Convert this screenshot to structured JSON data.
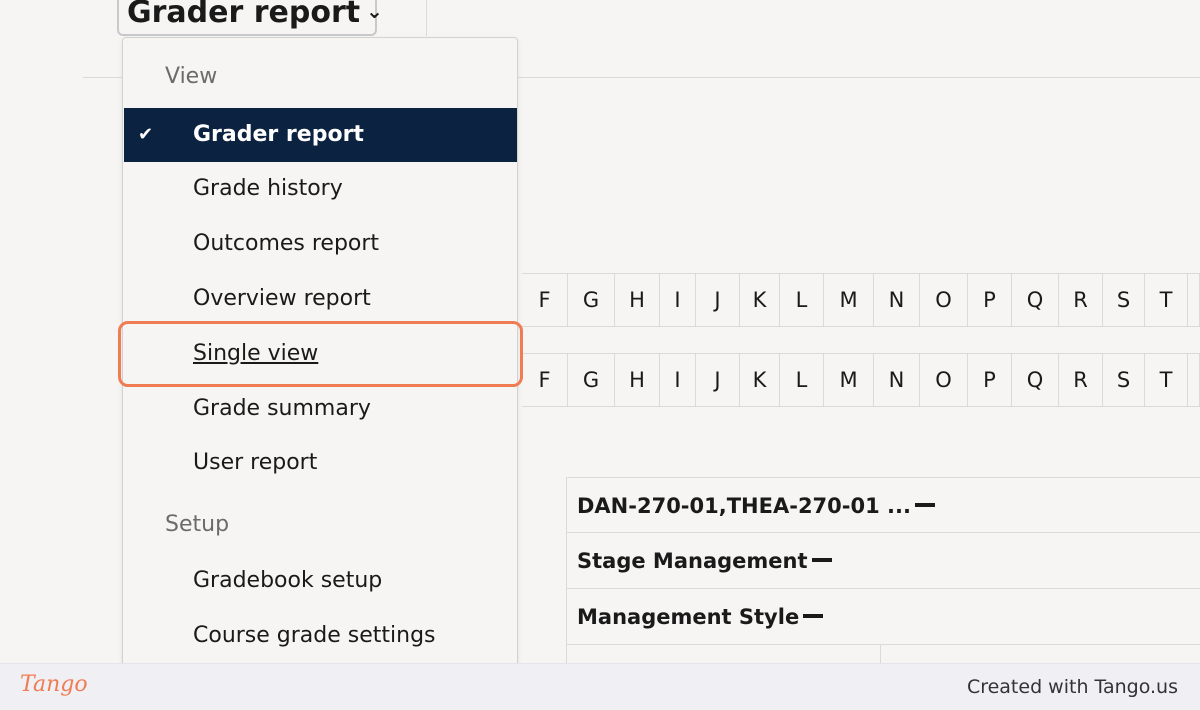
{
  "header": {
    "report_selector_value": "Grader report"
  },
  "letters_row_1": [
    "F",
    "G",
    "H",
    "I",
    "J",
    "K",
    "L",
    "M",
    "N",
    "O",
    "P",
    "Q",
    "R",
    "S",
    "T"
  ],
  "letters_row_2": [
    "F",
    "G",
    "H",
    "I",
    "J",
    "K",
    "L",
    "M",
    "N",
    "O",
    "P",
    "Q",
    "R",
    "S",
    "T"
  ],
  "grid": {
    "rows": [
      "DAN-270-01,THEA-270-01 ...",
      "Stage Management",
      "Management Style"
    ]
  },
  "dropdown": {
    "view_header": "View",
    "view_items": [
      {
        "label": "Grader report",
        "selected": true
      },
      {
        "label": "Grade history",
        "selected": false
      },
      {
        "label": "Outcomes report",
        "selected": false
      },
      {
        "label": "Overview report",
        "selected": false
      },
      {
        "label": "Single view",
        "selected": false,
        "hovered": true
      },
      {
        "label": "Grade summary",
        "selected": false
      },
      {
        "label": "User report",
        "selected": false
      }
    ],
    "setup_header": "Setup",
    "setup_items": [
      {
        "label": "Gradebook setup"
      },
      {
        "label": "Course grade settings"
      }
    ]
  },
  "footer": {
    "logo": "Tango",
    "created_text": "Created with Tango.us"
  },
  "colors": {
    "selected_bg": "#0b2241",
    "highlight": "#f07c54",
    "page_bg": "#f6f5f3"
  },
  "icons": {
    "selected_marker": "checkmark-icon",
    "selector_arrow": "chevron-down-icon"
  }
}
